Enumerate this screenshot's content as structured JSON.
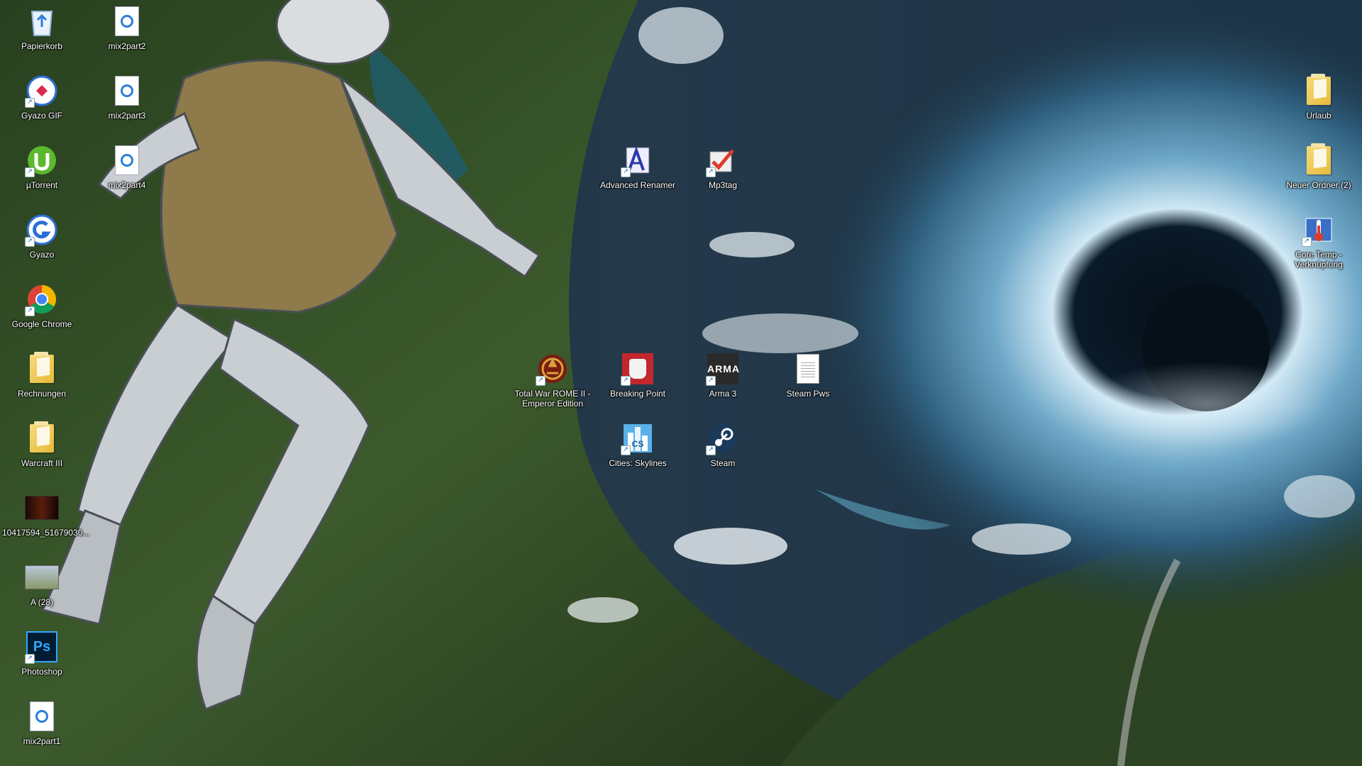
{
  "desktop": {
    "colors": {
      "sky_dark": "#0b1722",
      "vortex": "#6fa8c8",
      "earth_green": "#3c5a2c",
      "blackhole": "#061019",
      "astronaut": "#c9ced3"
    },
    "icons": [
      {
        "label": "Papierkorb",
        "icon": "recycle-bin-icon"
      },
      {
        "label": "mix2part2",
        "icon": "audio-file-icon"
      },
      {
        "label": "Gyazo GIF",
        "icon": "gyazo-gif-icon"
      },
      {
        "label": "mix2part3",
        "icon": "audio-file-icon"
      },
      {
        "label": "µTorrent",
        "icon": "utorrent-icon"
      },
      {
        "label": "mix2part4",
        "icon": "audio-file-icon"
      },
      {
        "label": "Gyazo",
        "icon": "gyazo-icon"
      },
      {
        "label": "Google Chrome",
        "icon": "chrome-icon"
      },
      {
        "label": "Rechnungen",
        "icon": "folder-icon"
      },
      {
        "label": "Warcraft III",
        "icon": "folder-icon"
      },
      {
        "label": "10417594_51679030...",
        "icon": "image-file-icon"
      },
      {
        "label": "A (28)",
        "icon": "image-file-icon"
      },
      {
        "label": "Photoshop",
        "icon": "photoshop-icon"
      },
      {
        "label": "mix2part1",
        "icon": "audio-file-icon"
      },
      {
        "label": "Advanced Renamer",
        "icon": "advanced-renamer-icon"
      },
      {
        "label": "Mp3tag",
        "icon": "mp3tag-icon"
      },
      {
        "label": "Total War ROME II - Emperor Edition",
        "icon": "rome2-icon"
      },
      {
        "label": "Breaking Point",
        "icon": "breaking-point-icon"
      },
      {
        "label": "Arma 3",
        "icon": "arma3-icon"
      },
      {
        "label": "Steam Pws",
        "icon": "text-file-icon"
      },
      {
        "label": "Cities: Skylines",
        "icon": "cities-skylines-icon"
      },
      {
        "label": "Steam",
        "icon": "steam-icon"
      },
      {
        "label": "Urlaub",
        "icon": "folder-icon"
      },
      {
        "label": "Neuer Ordner (2)",
        "icon": "folder-icon"
      },
      {
        "label": "Core Temp - Verknüpfung",
        "icon": "core-temp-icon"
      }
    ]
  }
}
